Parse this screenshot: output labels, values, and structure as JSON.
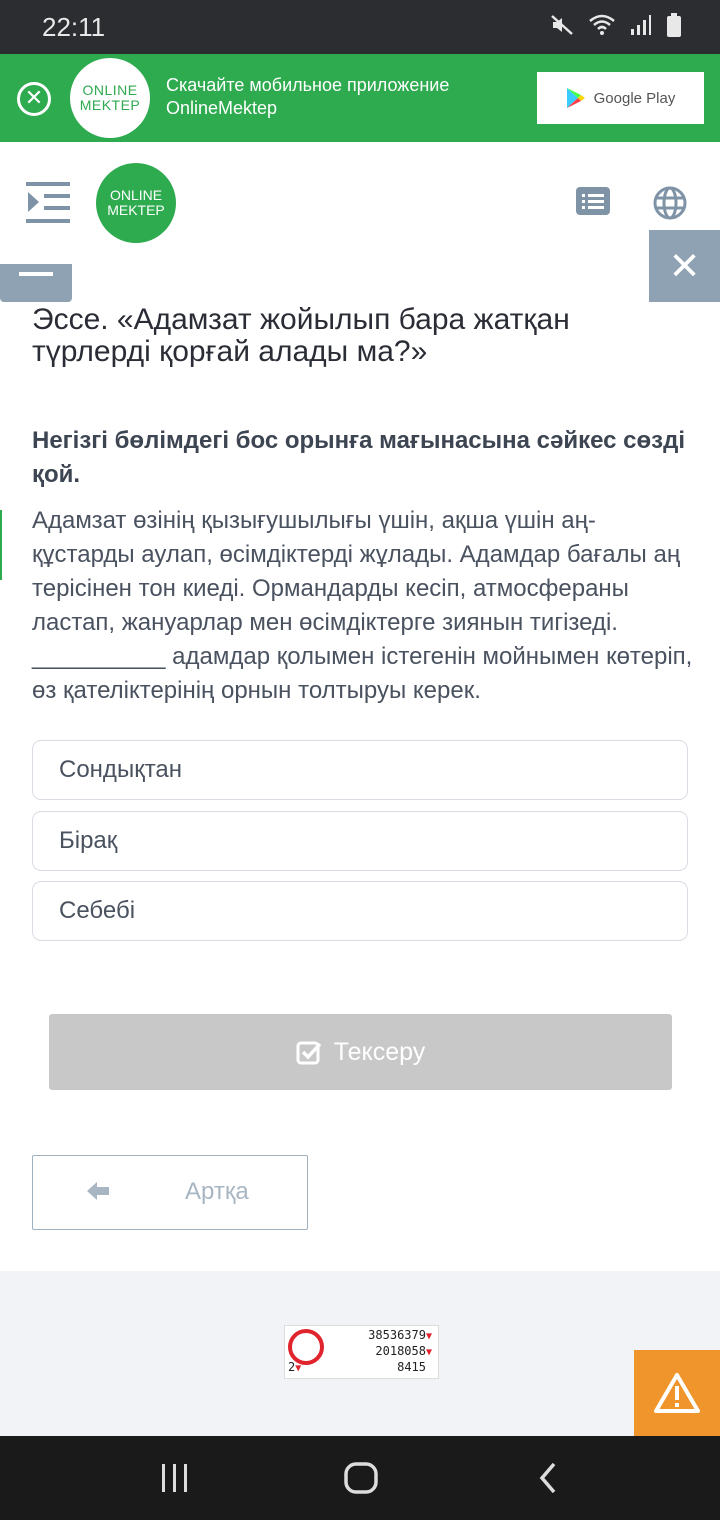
{
  "status_bar": {
    "time": "22:11"
  },
  "promo_banner": {
    "logo_line1": "ONLINE",
    "logo_line2": "MEKTEP",
    "text_line1": "Скачайте мобильное приложение",
    "text_line2": "OnlineMektep",
    "store_label": "Google Play"
  },
  "header": {
    "logo_line1": "ONLINE",
    "logo_line2": "MEKTEP"
  },
  "lesson": {
    "title": "Эссе. «Адамзат жойылып бара жатқан түрлерді қорғай алады ма?»",
    "instruction": "Негізгі бөлімдегі бос орынға мағынасына сәйкес сөзді қой.",
    "passage": "Адамзат өзінің қызығушылығы үшін, ақша үшін аң-құстарды аулап, өсімдіктерді жұлады. Адамдар бағалы аң терісінен тон киеді. Ормандарды кесіп, атмосфераны ластап, жануарлар мен өсімдіктерге зиянын тигізеді. __________ адамдар қолымен істегенін мойнымен көтеріп, өз қателіктерінің орнын толтыруы керек.",
    "options": [
      "Сондықтан",
      "Бірақ",
      "Себебі"
    ]
  },
  "actions": {
    "check_label": "Тексеру",
    "back_label": "Артқа"
  },
  "counter": {
    "line1": "38536379",
    "line2": "2018058",
    "line3": "8415",
    "line0": "2"
  },
  "colors": {
    "brand_green": "#2eaa4f",
    "warning_orange": "#f0952c",
    "muted_blue": "#8fa2b3"
  }
}
